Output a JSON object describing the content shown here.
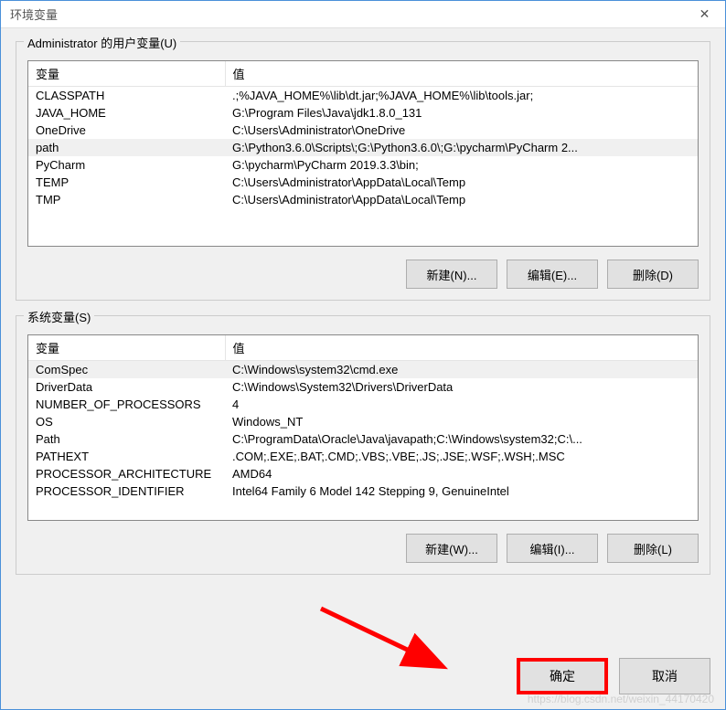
{
  "window": {
    "title": "环境变量",
    "close_label": "✕"
  },
  "user_section": {
    "group_label": "Administrator 的用户变量(U)",
    "header_name": "变量",
    "header_value": "值",
    "rows": [
      {
        "name": "CLASSPATH",
        "value": ".;%JAVA_HOME%\\lib\\dt.jar;%JAVA_HOME%\\lib\\tools.jar;"
      },
      {
        "name": "JAVA_HOME",
        "value": "G:\\Program Files\\Java\\jdk1.8.0_131"
      },
      {
        "name": "OneDrive",
        "value": "C:\\Users\\Administrator\\OneDrive"
      },
      {
        "name": "path",
        "value": "G:\\Python3.6.0\\Scripts\\;G:\\Python3.6.0\\;G:\\pycharm\\PyCharm 2..."
      },
      {
        "name": "PyCharm",
        "value": "G:\\pycharm\\PyCharm 2019.3.3\\bin;"
      },
      {
        "name": "TEMP",
        "value": "C:\\Users\\Administrator\\AppData\\Local\\Temp"
      },
      {
        "name": "TMP",
        "value": "C:\\Users\\Administrator\\AppData\\Local\\Temp"
      }
    ],
    "btn_new": "新建(N)...",
    "btn_edit": "编辑(E)...",
    "btn_delete": "删除(D)"
  },
  "system_section": {
    "group_label": "系统变量(S)",
    "header_name": "变量",
    "header_value": "值",
    "rows": [
      {
        "name": "ComSpec",
        "value": "C:\\Windows\\system32\\cmd.exe"
      },
      {
        "name": "DriverData",
        "value": "C:\\Windows\\System32\\Drivers\\DriverData"
      },
      {
        "name": "NUMBER_OF_PROCESSORS",
        "value": "4"
      },
      {
        "name": "OS",
        "value": "Windows_NT"
      },
      {
        "name": "Path",
        "value": "C:\\ProgramData\\Oracle\\Java\\javapath;C:\\Windows\\system32;C:\\..."
      },
      {
        "name": "PATHEXT",
        "value": ".COM;.EXE;.BAT;.CMD;.VBS;.VBE;.JS;.JSE;.WSF;.WSH;.MSC"
      },
      {
        "name": "PROCESSOR_ARCHITECTURE",
        "value": "AMD64"
      },
      {
        "name": "PROCESSOR_IDENTIFIER",
        "value": "Intel64 Family 6 Model 142 Stepping 9, GenuineIntel"
      }
    ],
    "btn_new": "新建(W)...",
    "btn_edit": "编辑(I)...",
    "btn_delete": "删除(L)"
  },
  "bottom": {
    "ok": "确定",
    "cancel": "取消"
  },
  "watermark": "https://blog.csdn.net/weixin_44170420"
}
